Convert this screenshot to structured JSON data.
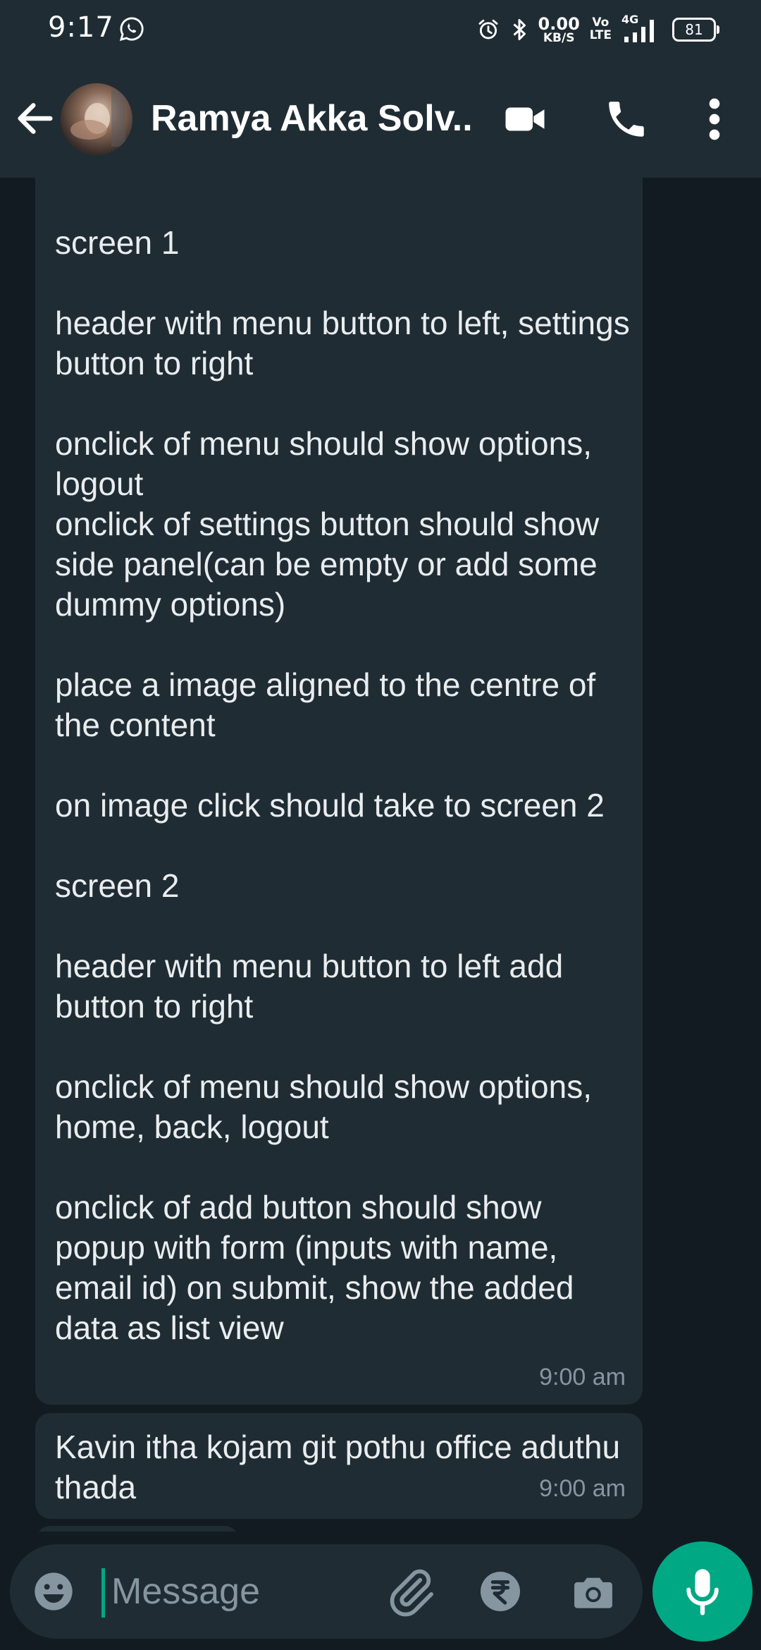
{
  "status_bar": {
    "time": "9:17",
    "net_speed_value": "0.00",
    "net_speed_unit": "KB/S",
    "volte_top": "Vo",
    "volte_bottom": "LTE",
    "network": "4G",
    "battery": "81",
    "icons": [
      "whatsapp-icon",
      "alarm-icon",
      "bluetooth-icon",
      "signal-icon",
      "battery-icon"
    ]
  },
  "header": {
    "title": "Ramya Akka Solv...",
    "icons": [
      "back-arrow-icon",
      "video-call-icon",
      "phone-icon",
      "more-vert-icon"
    ]
  },
  "messages": [
    {
      "text": "screen 1\n\nheader with menu button to left, settings button to right\n\nonclick of menu should show options, logout\nonclick of settings button should show side panel(can be empty or add some dummy options)\n\nplace a image aligned to the centre of the content\n\non image click should take to screen 2\n\nscreen 2\n\nheader with menu button to left add button to right\n\nonclick of menu should show options, home, back, logout\n\nonclick of add button should show popup with form (inputs with name, email id) on submit, show the added data as list view",
      "time": "9:00 am"
    },
    {
      "text": "Kavin itha kojam git pothu office aduthu thada",
      "time": "9:00 am"
    }
  ],
  "composer": {
    "placeholder": "Message",
    "icons": [
      "emoji-icon",
      "attach-icon",
      "rupee-icon",
      "camera-icon",
      "mic-icon"
    ]
  },
  "colors": {
    "background": "#121b22",
    "bar": "#1f2c34",
    "bubble": "#202c33",
    "text": "#e9edef",
    "meta": "#8696a0",
    "accent": "#00a884"
  }
}
